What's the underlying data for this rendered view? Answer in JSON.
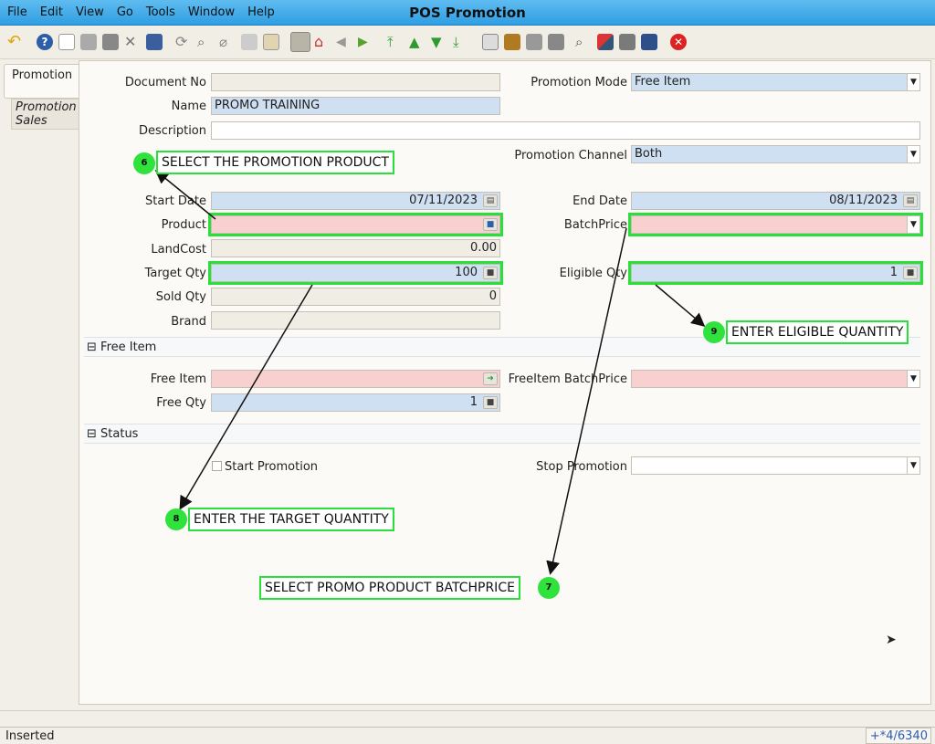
{
  "window": {
    "title": "POS Promotion",
    "menu": [
      "File",
      "Edit",
      "View",
      "Go",
      "Tools",
      "Window",
      "Help"
    ]
  },
  "toolbar": {
    "icons": [
      "undo-icon",
      "help-icon",
      "new-icon",
      "copy-icon",
      "delete-icon",
      "delete-selection-icon",
      "save-icon",
      "refresh-icon",
      "find-icon",
      "attachment-icon",
      "chat-icon",
      "grid-toggle-icon",
      "history-icon",
      "home-icon",
      "previous-icon",
      "next-icon",
      "first-record-icon",
      "previous-record-icon",
      "next-record-icon",
      "last-record-icon",
      "report-icon",
      "archive-icon",
      "print-preview-icon",
      "print-icon",
      "zoom-across-icon",
      "workflow-icon",
      "process-icon",
      "product-info-icon",
      "close-icon"
    ]
  },
  "tabs": [
    {
      "label": "Promotion"
    },
    {
      "label": "Promotion Sales"
    }
  ],
  "form": {
    "document_no": {
      "label": "Document No",
      "value": ""
    },
    "name": {
      "label": "Name",
      "value": "PROMO TRAINING"
    },
    "description": {
      "label": "Description",
      "value": ""
    },
    "promotion_mode": {
      "label": "Promotion Mode",
      "value": "Free Item"
    },
    "promotion_channel": {
      "label": "Promotion Channel",
      "value": "Both"
    },
    "start_date": {
      "label": "Start Date",
      "value": "07/11/2023"
    },
    "end_date": {
      "label": "End Date",
      "value": "08/11/2023"
    },
    "product": {
      "label": "Product",
      "value": ""
    },
    "batch_price": {
      "label": "BatchPrice",
      "value": ""
    },
    "land_cost": {
      "label": "LandCost",
      "value": "0.00"
    },
    "target_qty": {
      "label": "Target Qty",
      "value": "100"
    },
    "eligible_qty": {
      "label": "Eligible Qty",
      "value": "1"
    },
    "sold_qty": {
      "label": "Sold Qty",
      "value": "0"
    },
    "brand": {
      "label": "Brand",
      "value": ""
    },
    "free_item_section": {
      "label": "Free Item"
    },
    "free_item": {
      "label": "Free Item",
      "value": ""
    },
    "free_item_batch_price": {
      "label": "FreeItem BatchPrice",
      "value": ""
    },
    "free_qty": {
      "label": "Free Qty",
      "value": "1"
    },
    "status_section": {
      "label": "Status"
    },
    "start_promotion": {
      "label": "Start Promotion",
      "checked": false
    },
    "stop_promotion": {
      "label": "Stop Promotion",
      "value": ""
    }
  },
  "callouts": [
    {
      "number": "6",
      "text": "SELECT THE PROMOTION PRODUCT"
    },
    {
      "number": "9",
      "text": "ENTER ELIGIBLE QUANTITY"
    },
    {
      "number": "8",
      "text": "ENTER  THE TARGET QUANTITY"
    },
    {
      "number": "7",
      "text": "SELECT PROMO PRODUCT BATCHPRICE"
    }
  ],
  "status": {
    "message": "Inserted",
    "record": "+*4/6340"
  },
  "colors": {
    "titlebar": "#2f9ee2",
    "mandatory": "#f8d0d0",
    "editable": "#cfe0f3",
    "readonly": "#efede4",
    "annotation": "#29e03a"
  }
}
